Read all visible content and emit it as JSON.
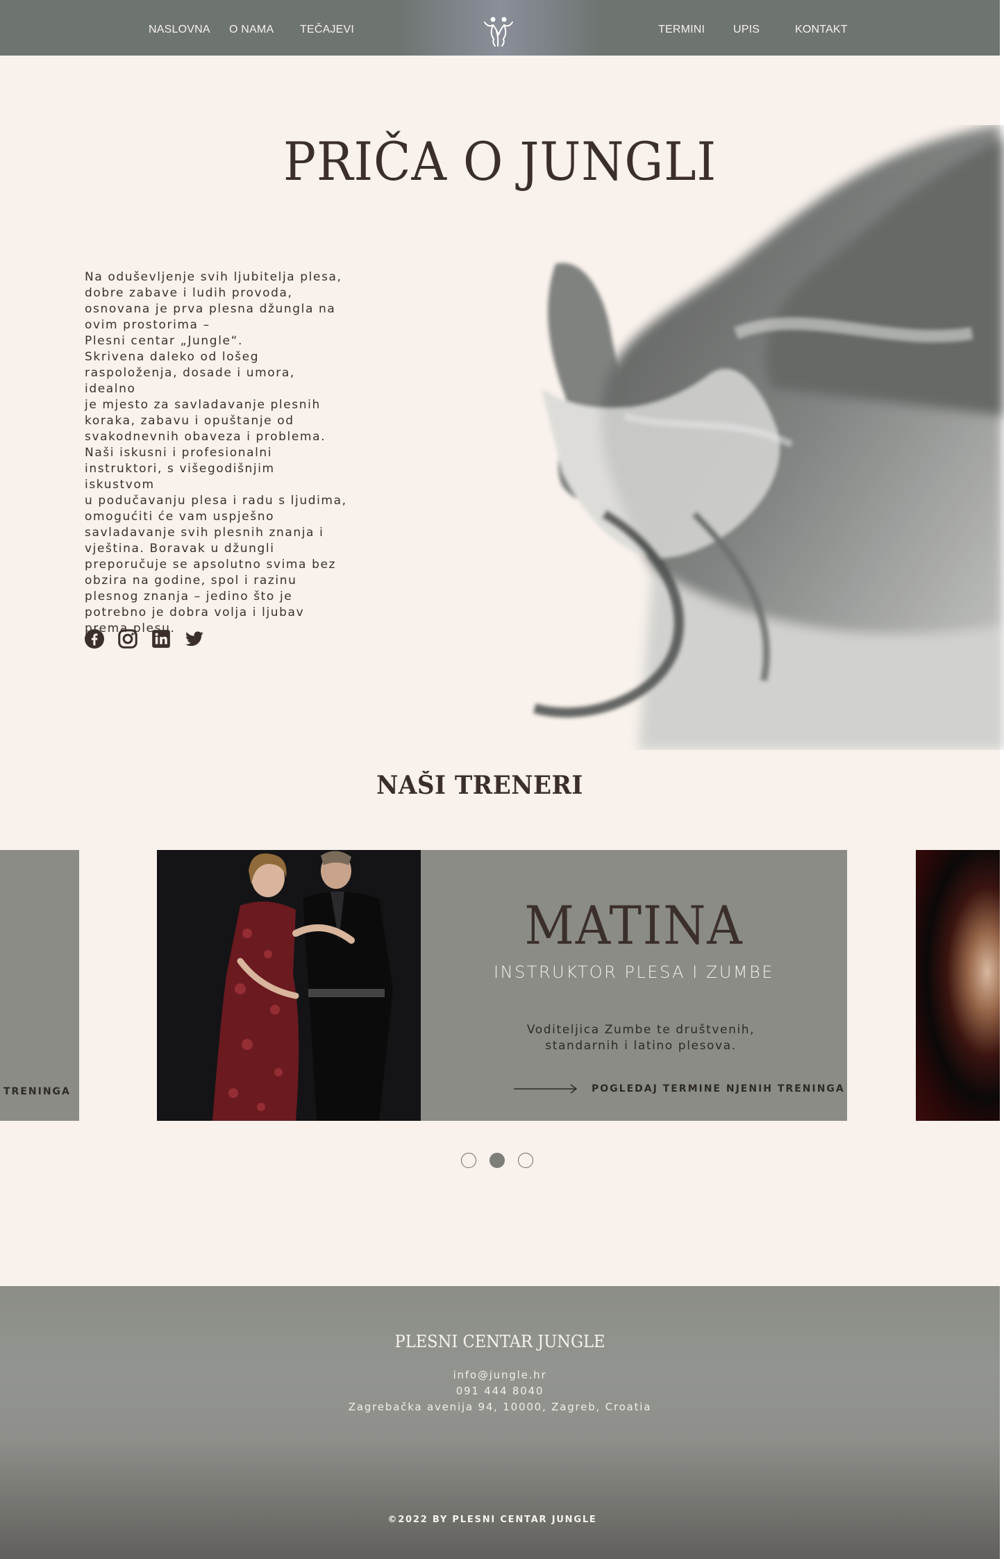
{
  "nav": {
    "items": [
      "NASLOVNA",
      "O NAMA",
      "TEČAJEVI",
      "TERMINI",
      "UPIS",
      "KONTAKT"
    ]
  },
  "hero": {
    "title": "PRIČA O JUNGLI",
    "story": "Na oduševljenje svih ljubitelja plesa,\ndobre zabave i ludih provoda,\nosnovana je prva plesna džungla na\novim prostorima –\nPlesni centar „Jungle“.\nSkrivena daleko od lošeg\nraspoloženja, dosade i umora, idealno\nje mjesto za savladavanje plesnih\nkoraka, zabavu i opuštanje od\nsvakodnevnih obaveza i problema.\nNaši iskusni i profesionalni\ninstruktori, s višegodišnjim iskustvom\nu podučavanju plesa i radu s ljudima,\nomogućiti će vam uspješno\nsavladavanje svih plesnih znanja i\nvještina. Boravak u džungli\npreporučuje se apsolutno svima bez\nobzira na godine, spol i razinu\nplesnog znanja – jedino što je\npotrebno je dobra volja i ljubav\nprema plesu.",
    "social_icons": [
      "facebook-icon",
      "instagram-icon",
      "linkedin-icon",
      "twitter-icon"
    ]
  },
  "trainers": {
    "title": "NAŠI TRENERI",
    "prev_slide_cta": "TRENINGA",
    "active": {
      "name": "MATINA",
      "role": "INSTRUKTOR PLESA I ZUMBE",
      "description": "Voditeljica Zumbe te društvenih,\nstandarnih i latino plesova.",
      "cta": "POGLEDAJ TERMINE NJENIH TRENINGA"
    },
    "dots": 3,
    "active_dot": 1
  },
  "footer": {
    "title": "PLESNI CENTAR JUNGLE",
    "email": "info@jungle.hr",
    "phone": "091 444 8040",
    "address": "Zagrebačka avenija 94, 10000, Zagreb, Croatia",
    "copyright": "©2022 BY PLESNI CENTAR JUNGLE"
  },
  "colors": {
    "background": "#f8f1ec",
    "nav": "#6e7470",
    "card": "#8a8c85",
    "text": "#3b2f2c"
  }
}
